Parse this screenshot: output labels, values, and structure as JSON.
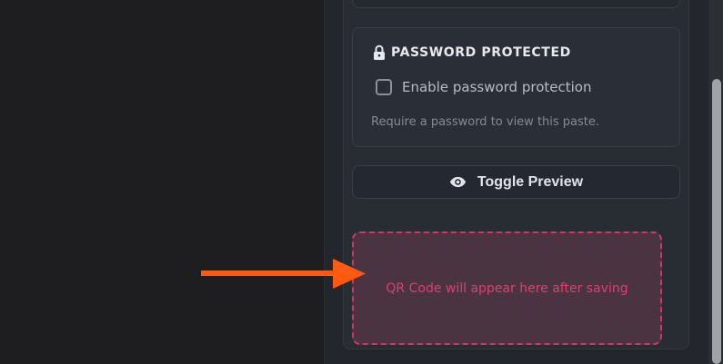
{
  "password_section": {
    "title": "PASSWORD PROTECTED",
    "checkbox_label": "Enable password protection",
    "help_text": "Require a password to view this paste.",
    "checked": false,
    "lock_icon": "lock-icon"
  },
  "preview": {
    "button_label": "Toggle Preview",
    "icon": "eye-icon"
  },
  "qr": {
    "placeholder_text": "QR Code will appear here after saving"
  },
  "colors": {
    "accent": "#d53562",
    "arrow": "#ff5a10",
    "panel_bg": "#282c33"
  }
}
